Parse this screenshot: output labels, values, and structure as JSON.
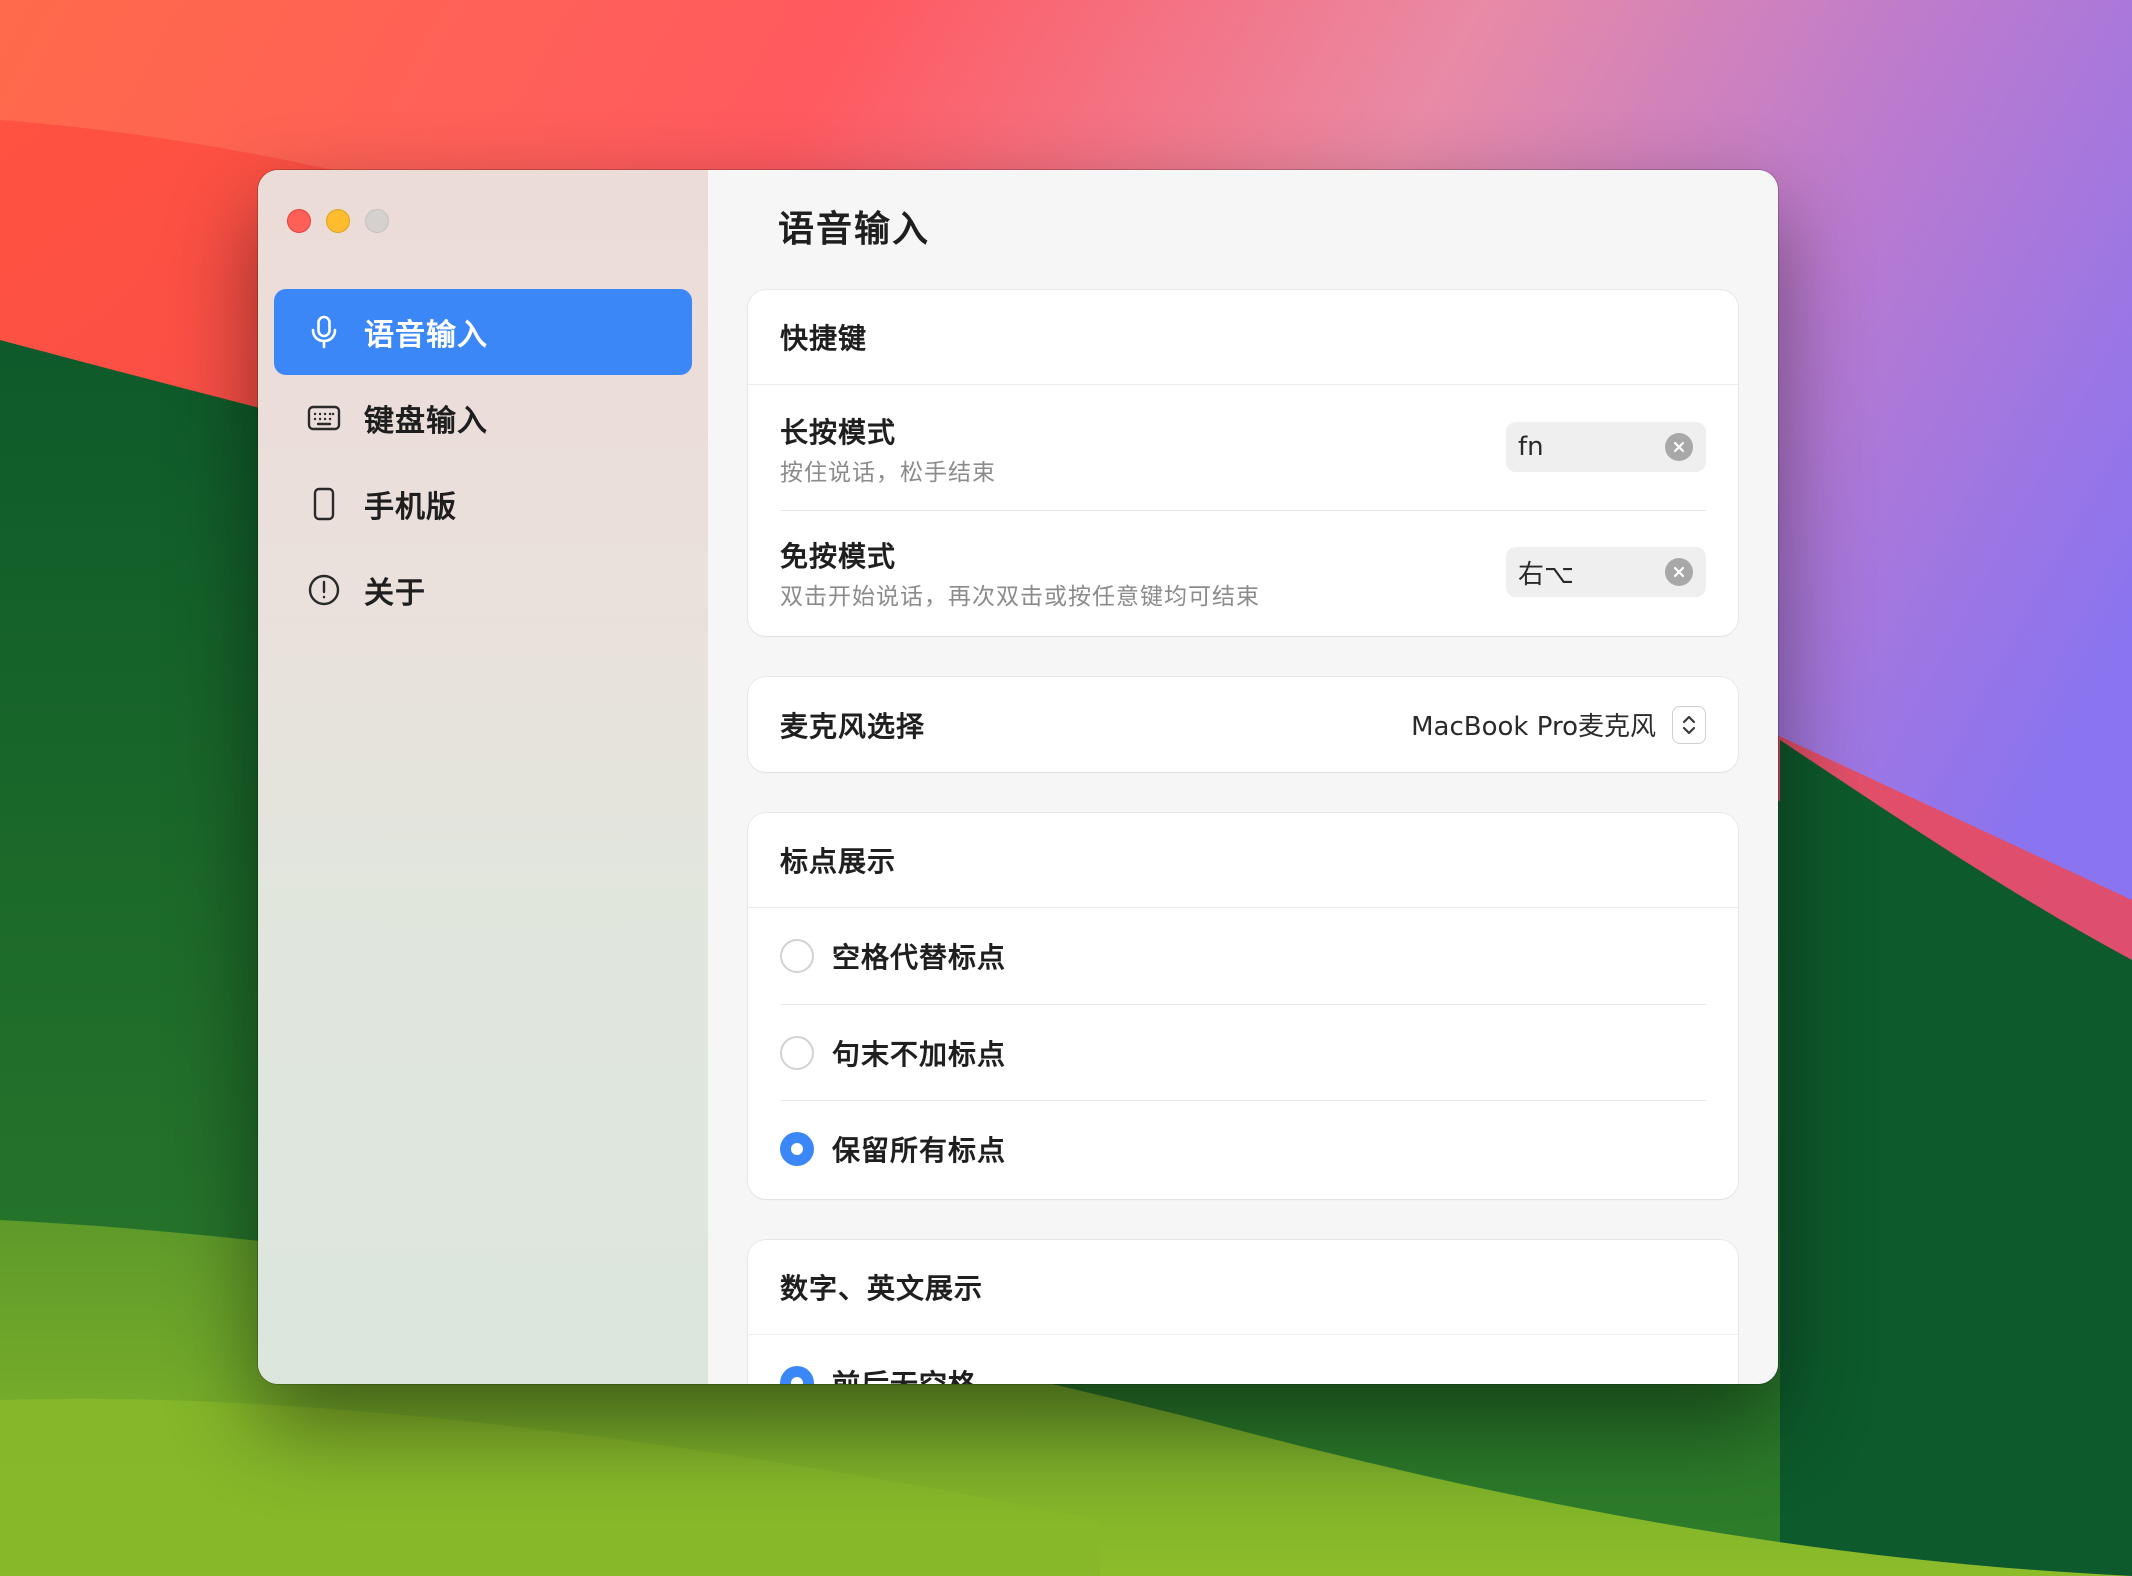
{
  "sidebar": {
    "items": [
      {
        "label": "语音输入",
        "icon": "microphone-icon",
        "active": true
      },
      {
        "label": "键盘输入",
        "icon": "keyboard-icon",
        "active": false
      },
      {
        "label": "手机版",
        "icon": "phone-icon",
        "active": false
      },
      {
        "label": "关于",
        "icon": "info-icon",
        "active": false
      }
    ]
  },
  "main": {
    "title": "语音输入",
    "shortcuts": {
      "header": "快捷键",
      "hold": {
        "title": "长按模式",
        "subtitle": "按住说话，松手结束",
        "value": "fn"
      },
      "handsfree": {
        "title": "免按模式",
        "subtitle": "双击开始说话，再次双击或按任意键均可结束",
        "value": "右⌥"
      }
    },
    "microphone": {
      "label": "麦克风选择",
      "value": "MacBook Pro麦克风"
    },
    "punctuation": {
      "header": "标点展示",
      "options": [
        {
          "label": "空格代替标点",
          "selected": false
        },
        {
          "label": "句末不加标点",
          "selected": false
        },
        {
          "label": "保留所有标点",
          "selected": true
        }
      ]
    },
    "numbers": {
      "header": "数字、英文展示",
      "options": [
        {
          "label": "前后无空格",
          "selected": true
        }
      ]
    }
  },
  "colors": {
    "accent": "#3c87f7",
    "close": "#fe5f57",
    "minimize": "#febc2e"
  }
}
